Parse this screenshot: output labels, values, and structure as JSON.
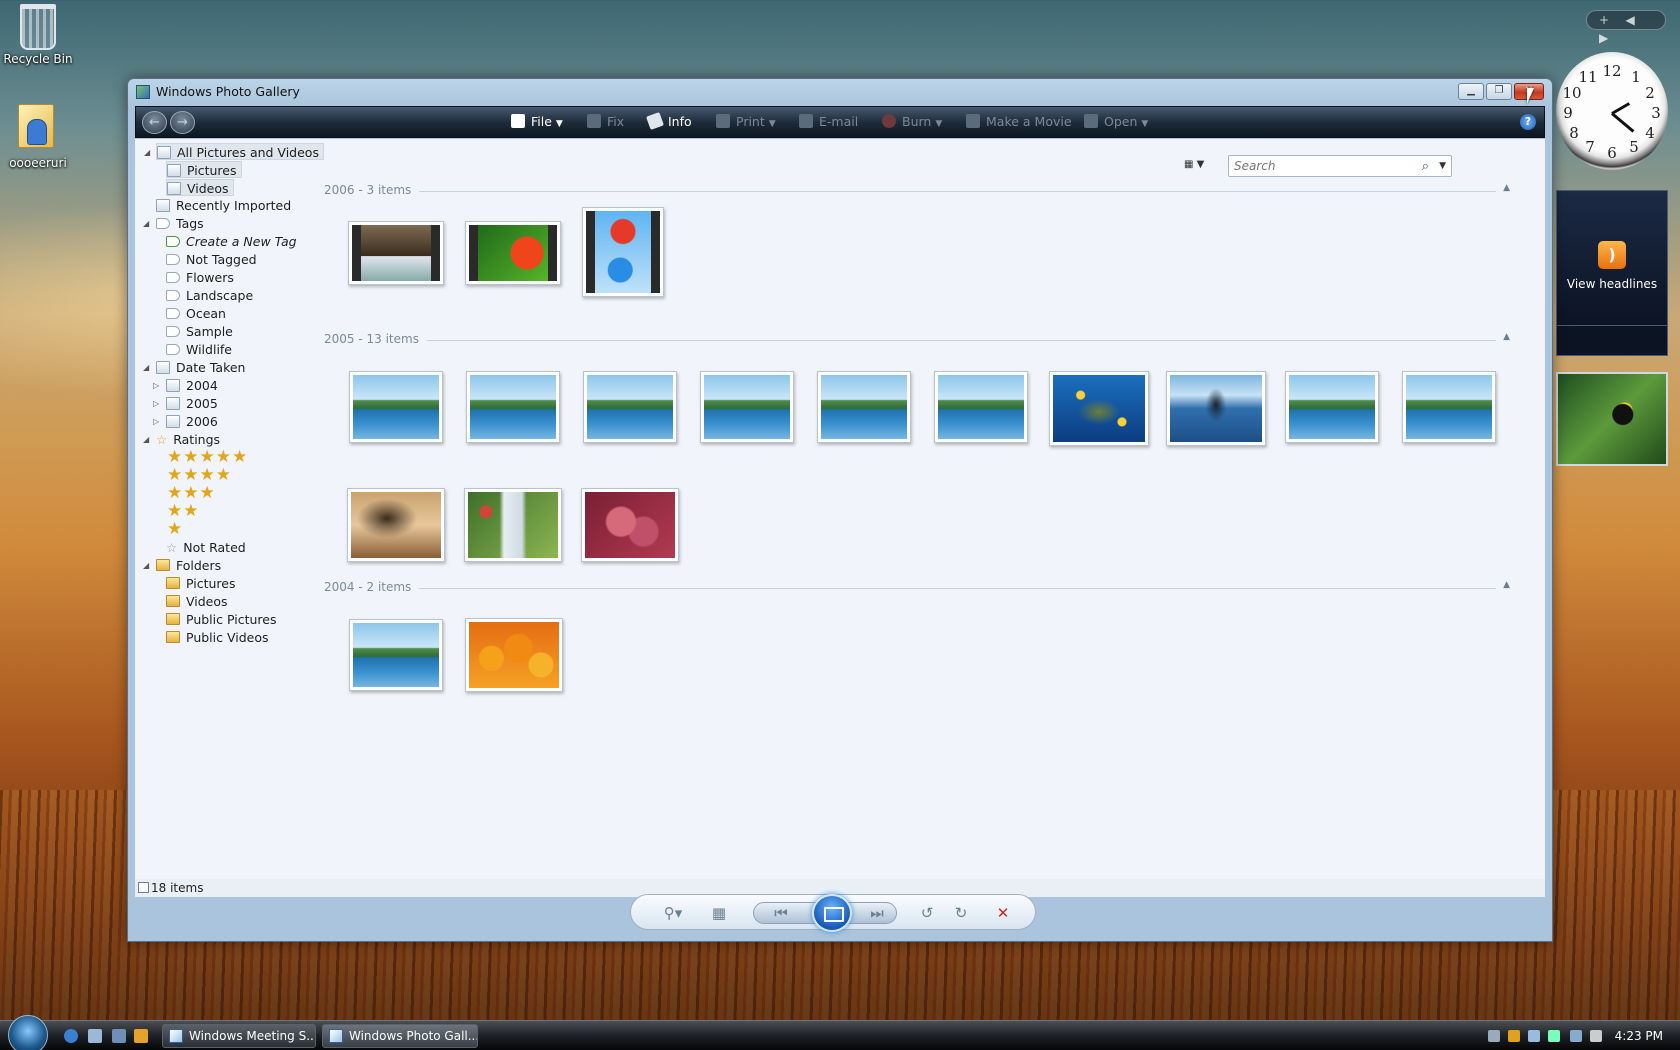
{
  "desktop": {
    "icons": [
      {
        "label": "Recycle Bin"
      },
      {
        "label": "oooeeruri"
      }
    ],
    "gadgets": {
      "top_controls": [
        "+",
        "◀",
        "▶"
      ],
      "clock_numbers": [
        "12",
        "1",
        "2",
        "3",
        "4",
        "5",
        "6",
        "7",
        "8",
        "9",
        "10",
        "11"
      ],
      "rss_label": "View headlines"
    }
  },
  "window": {
    "title": "Windows Photo Gallery",
    "controls": [
      "minimize",
      "maximize",
      "close"
    ]
  },
  "toolbar": {
    "items": [
      {
        "label": "File",
        "enabled": true,
        "dropdown": true
      },
      {
        "label": "Fix",
        "enabled": false,
        "dropdown": false
      },
      {
        "label": "Info",
        "enabled": true,
        "dropdown": false
      },
      {
        "label": "Print",
        "enabled": false,
        "dropdown": true
      },
      {
        "label": "E-mail",
        "enabled": false,
        "dropdown": false
      },
      {
        "label": "Burn",
        "enabled": false,
        "dropdown": true
      },
      {
        "label": "Make a Movie",
        "enabled": false,
        "dropdown": false
      },
      {
        "label": "Open",
        "enabled": false,
        "dropdown": true
      }
    ],
    "help": "?"
  },
  "navigation": {
    "all": "All Pictures and Videos",
    "pictures": "Pictures",
    "videos": "Videos",
    "recently_imported": "Recently Imported",
    "tags": "Tags",
    "create_tag": "Create a New Tag",
    "not_tagged": "Not Tagged",
    "tag_items": [
      "Flowers",
      "Landscape",
      "Ocean",
      "Sample",
      "Wildlife"
    ],
    "date_taken": "Date Taken",
    "years": [
      "2004",
      "2005",
      "2006"
    ],
    "ratings": "Ratings",
    "rating_rows": [
      "★★★★★",
      "★★★★",
      "★★★",
      "★★",
      "★"
    ],
    "not_rated": "Not Rated",
    "folders": "Folders",
    "folder_items": [
      "Pictures",
      "Videos",
      "Public Pictures",
      "Public Videos"
    ]
  },
  "search": {
    "placeholder": "Search"
  },
  "groups": [
    {
      "label": "2006 - 3 items"
    },
    {
      "label": "2005 - 13 items"
    },
    {
      "label": "2004 - 2 items"
    }
  ],
  "status": {
    "count": "18 items"
  },
  "taskbar": {
    "buttons": [
      "Windows Meeting S...",
      "Windows Photo Gall..."
    ],
    "time": "4:23 PM"
  }
}
